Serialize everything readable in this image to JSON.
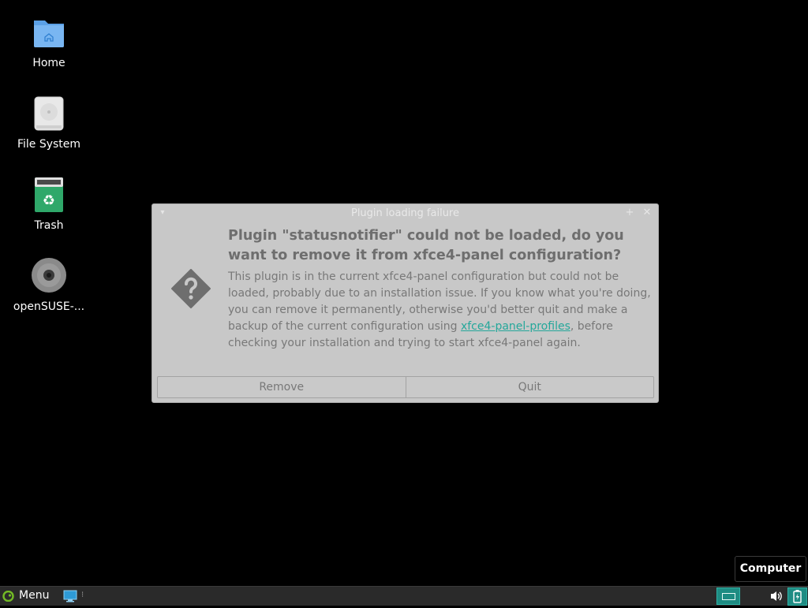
{
  "desktop": {
    "icons": [
      {
        "label": "Home",
        "icon": "home-folder-icon"
      },
      {
        "label": "File System",
        "icon": "hard-drive-icon"
      },
      {
        "label": "Trash",
        "icon": "trash-icon"
      },
      {
        "label": "openSUSE-...",
        "icon": "optical-disc-icon"
      }
    ]
  },
  "dialog": {
    "title": "Plugin loading failure",
    "heading": "Plugin \"statusnotifier\" could not be loaded, do you want to remove it from xfce4-panel configuration?",
    "body_before_link": "This plugin is in the current xfce4-panel configuration but could not be loaded, probably due to an installation issue. If you know what you're doing, you can remove it permanently, otherwise you'd better quit and make a backup of the current configuration using ",
    "link_text": "xfce4-panel-profiles",
    "body_after_link": ", before checking your installation and trying to start xfce4-panel again.",
    "buttons": {
      "remove": "Remove",
      "quit": "Quit"
    },
    "icon": "question-icon"
  },
  "tooltip": {
    "text": "Computer"
  },
  "panel": {
    "menu_label": "Menu",
    "colors": {
      "accent": "#1e8c83",
      "panel_bg": "#2a2a2a",
      "link": "#24a79a"
    }
  }
}
